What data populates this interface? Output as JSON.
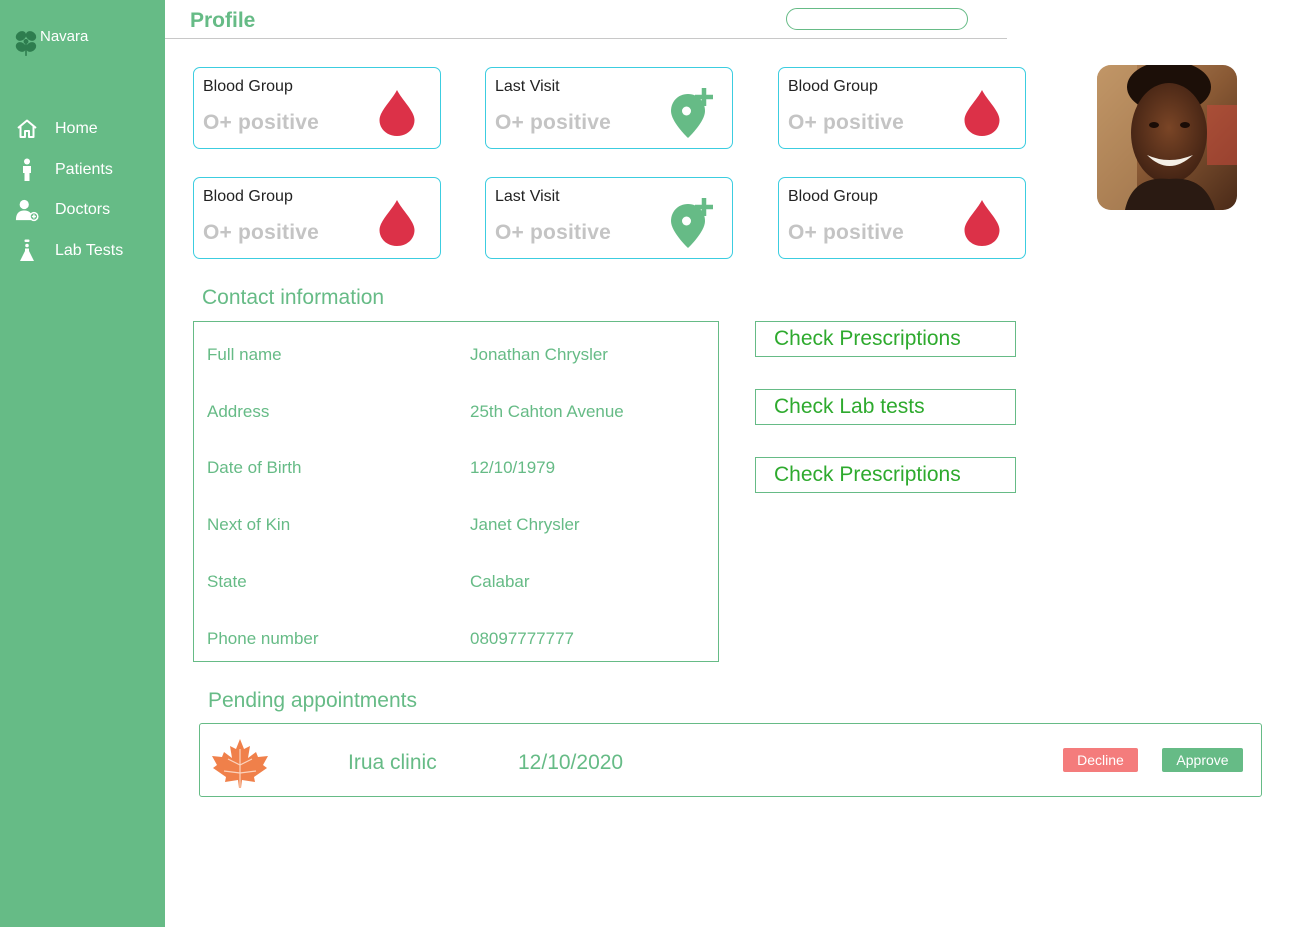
{
  "app": {
    "name": "Navara",
    "logo_icon": "clover-icon"
  },
  "sidebar": {
    "items": [
      {
        "label": "Home",
        "icon": "home-icon"
      },
      {
        "label": "Patients",
        "icon": "person-icon"
      },
      {
        "label": "Doctors",
        "icon": "doctor-icon"
      },
      {
        "label": "Lab Tests",
        "icon": "flask-icon"
      }
    ]
  },
  "header": {
    "title": "Profile",
    "search": {
      "placeholder": "",
      "value": ""
    }
  },
  "stats": [
    {
      "label": "Blood Group",
      "value": "O+ positive",
      "icon": "blood-drop-icon"
    },
    {
      "label": "Last Visit",
      "value": "O+ positive",
      "icon": "location-plus-icon"
    },
    {
      "label": "Blood Group",
      "value": "O+ positive",
      "icon": "blood-drop-icon"
    },
    {
      "label": "Blood Group",
      "value": "O+ positive",
      "icon": "blood-drop-icon"
    },
    {
      "label": "Last Visit",
      "value": "O+ positive",
      "icon": "location-plus-icon"
    },
    {
      "label": "Blood Group",
      "value": "O+ positive",
      "icon": "blood-drop-icon"
    }
  ],
  "contact": {
    "title": "Contact information",
    "rows": [
      {
        "label": "Full name",
        "value": "Jonathan Chrysler"
      },
      {
        "label": "Address",
        "value": "25th Cahton Avenue"
      },
      {
        "label": "Date of Birth",
        "value": "12/10/1979"
      },
      {
        "label": "Next of Kin",
        "value": "Janet Chrysler"
      },
      {
        "label": "State",
        "value": "Calabar"
      },
      {
        "label": "Phone number",
        "value": "08097777777"
      }
    ]
  },
  "actions": [
    {
      "label": "Check Prescriptions"
    },
    {
      "label": "Check Lab tests"
    },
    {
      "label": "Check Prescriptions"
    }
  ],
  "appointments": {
    "title": "Pending appointments",
    "items": [
      {
        "icon": "maple-leaf-icon",
        "clinic": "Irua clinic",
        "date": "12/10/2020",
        "decline_label": "Decline",
        "approve_label": "Approve"
      }
    ]
  },
  "colors": {
    "brand_green": "#66bb86",
    "card_border": "#3ccde0",
    "blood_red": "#dc3148",
    "decline_red": "#f47c7c",
    "action_text": "#2eaa2e",
    "leaf_orange": "#f0804a"
  }
}
